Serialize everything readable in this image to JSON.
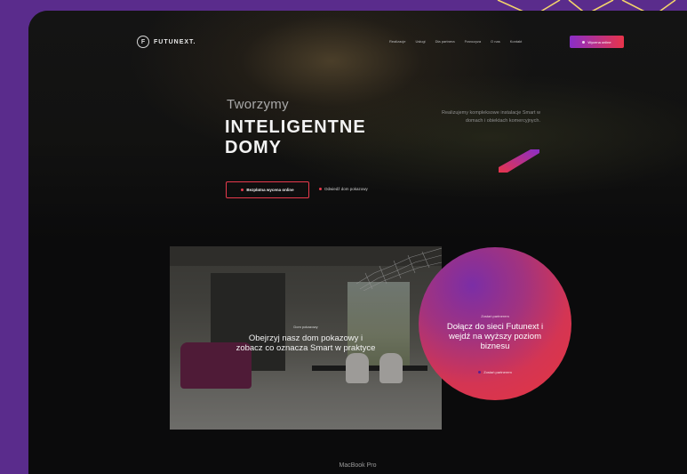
{
  "colors": {
    "background": "#5a2c8c",
    "accent_purple": "#8a2ec8",
    "accent_red": "#e83a4d",
    "outline_yellow": "#f2d36b"
  },
  "nav": {
    "logo": "FUTUNEXT.",
    "logo_icon": "logo-ring-icon",
    "menu": [
      "Realizacje",
      "Usługi",
      "Dla partnera",
      "Franczyza",
      "O nas",
      "Kontakt"
    ],
    "cta": "Wycena online"
  },
  "hero": {
    "subtitle": "Tworzymy",
    "title_line1": "INTELIGENTNE",
    "title_line2": "DOMY",
    "description": "Realizujemy kompleksowe instalacje Smart w domach i obiektach komercyjnych.",
    "primary_button": "Bezpłatna wycena online",
    "secondary_link": "Odwiedź dom pokazowy"
  },
  "showroom": {
    "kicker": "Dom pokazowy",
    "title": "Obejrzyj nasz dom pokazowy i zobacz co oznacza Smart w praktyce"
  },
  "partner": {
    "kicker": "Zostań partnerem",
    "title": "Dołącz do sieci Futunext i wejdź na wyższy poziom biznesu",
    "link": "Zostań partnerem"
  },
  "device_caption": "MacBook Pro"
}
